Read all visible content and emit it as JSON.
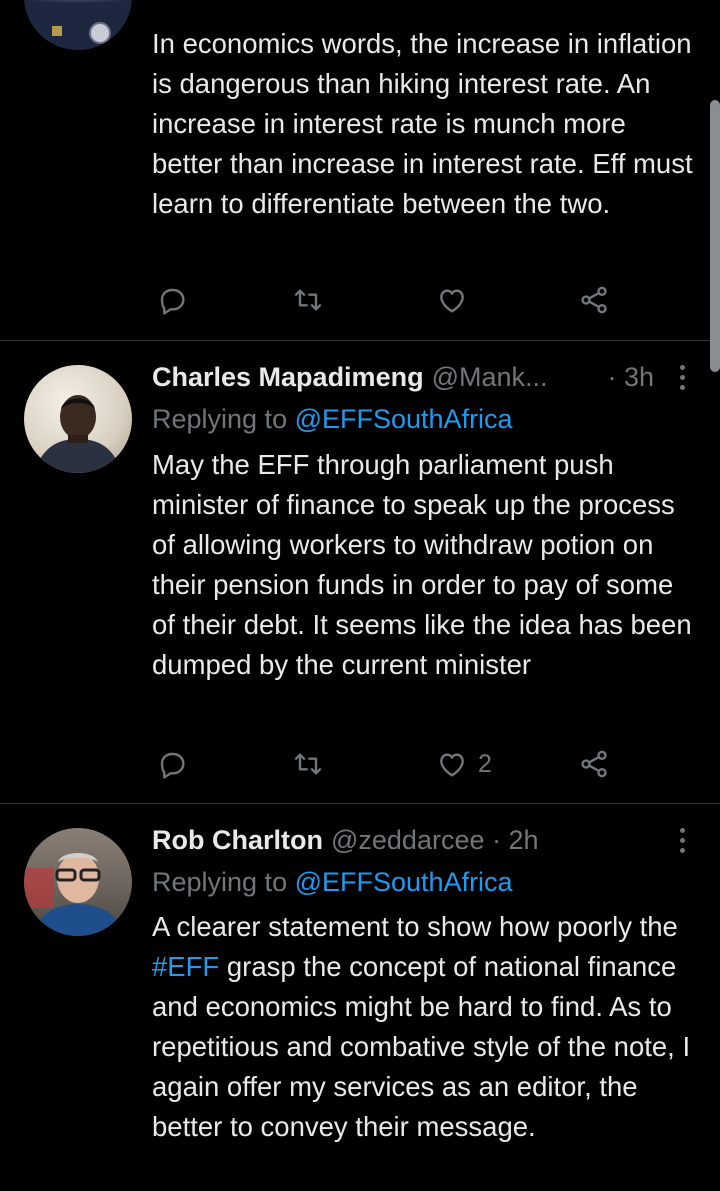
{
  "tweets": [
    {
      "text": "In economics words, the increase in inflation is dangerous than hiking interest rate. An increase in interest rate is munch more better than increase in interest rate. Eff must learn to differentiate between the two.",
      "likes": ""
    },
    {
      "name": "Charles Mapadimeng",
      "handle": "@Mank...",
      "time": "· 3h",
      "replying_label": "Replying to ",
      "replying_to": "@EFFSouthAfrica",
      "text": "May the EFF through parliament push minister of finance to speak up the process of allowing workers to withdraw potion on their pension funds in order to pay of some of their debt. It seems like the idea has been dumped by the current minister",
      "likes": "2"
    },
    {
      "name": "Rob Charlton",
      "handle": "@zeddarcee",
      "time": " · 2h",
      "replying_label": "Replying to ",
      "replying_to": "@EFFSouthAfrica",
      "text_before_tag": "A clearer statement to show how poorly the ",
      "hashtag": "#EFF",
      "text_after_tag": " grasp the concept of national finance and economics might be hard to find. As to repetitious and combative style of the note, I again offer my services as an editor, the better to convey their message."
    }
  ],
  "icons": [
    "reply-icon",
    "retweet-icon",
    "like-icon",
    "share-icon",
    "more-icon"
  ],
  "colors": {
    "background": "#000000",
    "text": "#e7e9ea",
    "muted": "#71767b",
    "link": "#1d9bf0",
    "divider": "#2f3336"
  }
}
